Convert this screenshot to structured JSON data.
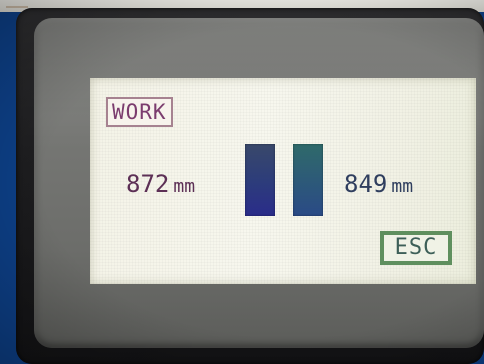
{
  "display": {
    "mode_label": "WORK",
    "left_reading": {
      "value": "872",
      "unit": "mm"
    },
    "right_reading": {
      "value": "849",
      "unit": "mm"
    },
    "esc_label": "ESC"
  },
  "colors": {
    "screen_background": "#f4f3e7",
    "mode_text": "#7b3c6e",
    "left_column": "#2d3d7a",
    "right_column": "#2d5a78",
    "esc_border": "#5f8f5e"
  }
}
